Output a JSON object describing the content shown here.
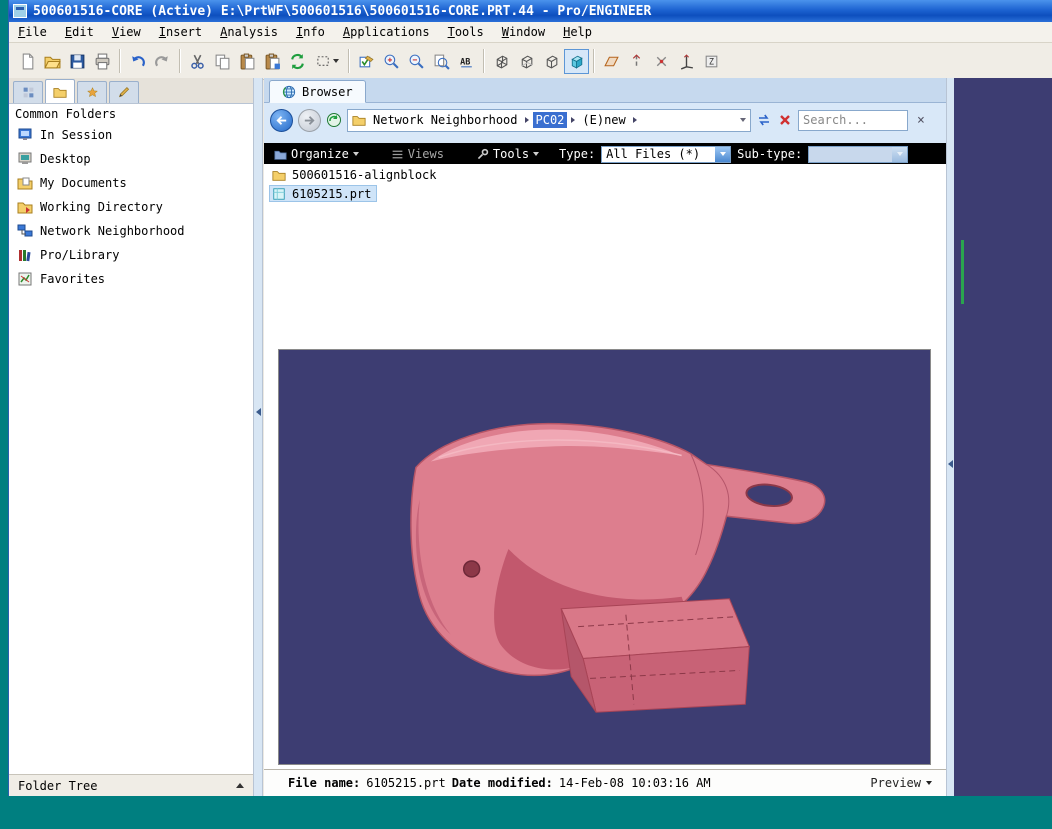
{
  "window": {
    "title": "500601516-CORE (Active) E:\\PrtWF\\500601516\\500601516-CORE.PRT.44 - Pro/ENGINEER"
  },
  "menu": {
    "items": [
      "File",
      "Edit",
      "View",
      "Insert",
      "Analysis",
      "Info",
      "Applications",
      "Tools",
      "Window",
      "Help"
    ]
  },
  "toolbar": {
    "icons": [
      "new-file-icon",
      "open-icon",
      "save-icon",
      "print-icon",
      "undo-icon",
      "redo-icon",
      "cut-icon",
      "copy-icon",
      "paste-icon",
      "paste-special-icon",
      "regenerate-icon",
      "selection-filter-icon",
      "edit-select-icon",
      "zoom-in-icon",
      "zoom-out-icon",
      "refit-icon",
      "find-icon",
      "wireframe-icon",
      "hidden-line-icon",
      "no-hidden-icon",
      "shaded-icon",
      "datum-plane-icon",
      "datum-axis-icon",
      "datum-point-icon",
      "csys-icon",
      "annotation-icon"
    ]
  },
  "navigator": {
    "header": "Common Folders",
    "items": [
      {
        "label": "In Session"
      },
      {
        "label": "Desktop"
      },
      {
        "label": "My Documents"
      },
      {
        "label": "Working Directory"
      },
      {
        "label": "Network Neighborhood"
      },
      {
        "label": "Pro/Library"
      },
      {
        "label": "Favorites"
      }
    ],
    "folder_tree_label": "Folder Tree"
  },
  "browser": {
    "tab_label": "Browser",
    "address": {
      "crumbs": [
        "Network Neighborhood",
        "PC02",
        "(E)new"
      ],
      "selected_crumb": "PC02",
      "search_placeholder": "Search..."
    },
    "command_bar": {
      "organize": "Organize",
      "views": "Views",
      "tools": "Tools",
      "type_label": "Type:",
      "type_value": "All Files (*)",
      "subtype_label": "Sub-type:"
    },
    "files": [
      {
        "name": "500601516-alignblock",
        "icon": "folder-icon"
      },
      {
        "name": "6105215.prt",
        "icon": "part-icon"
      }
    ],
    "statusbar": {
      "file_name_label": "File name:",
      "file_name": "6105215.prt",
      "date_label": "Date modified:",
      "date_value": "14-Feb-08 10:03:16 AM",
      "preview_label": "Preview"
    }
  },
  "preview": {
    "background_color": "#3d3d72",
    "model_color": "#dd7e8e"
  }
}
